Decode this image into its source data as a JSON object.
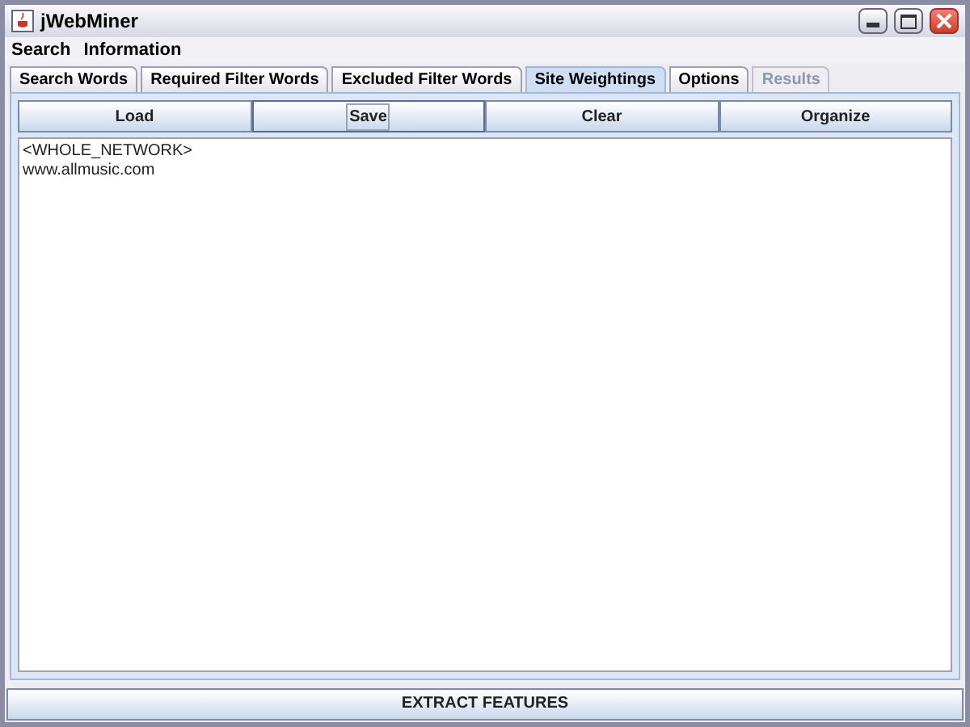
{
  "window": {
    "title": "jWebMiner"
  },
  "menu": [
    "Search",
    "Information"
  ],
  "tabs": [
    {
      "label": "Search Words",
      "selected": false,
      "disabled": false
    },
    {
      "label": "Required Filter Words",
      "selected": false,
      "disabled": false
    },
    {
      "label": "Excluded Filter Words",
      "selected": false,
      "disabled": false
    },
    {
      "label": "Site Weightings",
      "selected": true,
      "disabled": false
    },
    {
      "label": "Options",
      "selected": false,
      "disabled": false
    },
    {
      "label": "Results",
      "selected": false,
      "disabled": true
    }
  ],
  "buttons": [
    {
      "label": "Load",
      "focused": false
    },
    {
      "label": "Save",
      "focused": true
    },
    {
      "label": "Clear",
      "focused": false
    },
    {
      "label": "Organize",
      "focused": false
    }
  ],
  "text_area": {
    "lines": [
      "<WHOLE_NETWORK>",
      "www.allmusic.com"
    ]
  },
  "action_button": {
    "label": "EXTRACT FEATURES"
  }
}
